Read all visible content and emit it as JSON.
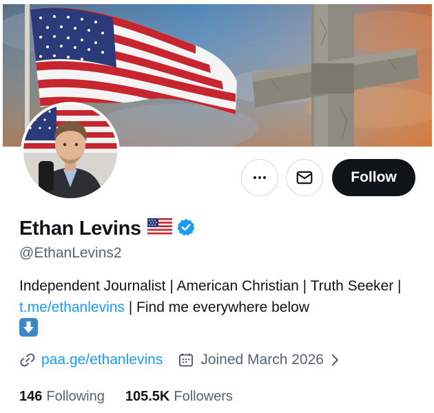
{
  "profile": {
    "display_name": "Ethan Levins",
    "handle": "@EthanLevins2",
    "flag_icon": "us-flag-emoji",
    "verified_icon": "verified-badge-icon",
    "bio": {
      "part1": "Independent Journalist | American Christian | Truth Seeker | ",
      "link": "t.me/ethanlevins",
      "part2": " | Find me everywhere below ",
      "emoji": "down-arrow-emoji"
    },
    "website": "paa.ge/ethanlevins",
    "joined": "Joined March 2026",
    "following_count": "146",
    "following_label": "Following",
    "followers_count": "105.5K",
    "followers_label": "Followers"
  },
  "actions": {
    "more_icon": "more-icon",
    "message_icon": "envelope-icon",
    "follow_label": "Follow"
  },
  "colors": {
    "accent": "#1d9bf0",
    "primary_text": "#0f1419",
    "secondary_text": "#536471",
    "follow_bg": "#0f1419"
  }
}
